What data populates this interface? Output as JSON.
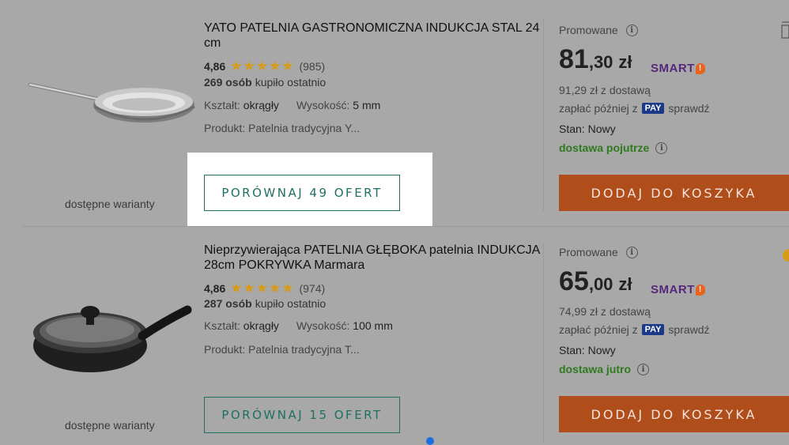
{
  "products": [
    {
      "title": "YATO PATELNIA GASTRONOMICZNA INDUKCJA STAL 24 cm",
      "rating": "4,86",
      "stars": "★★★★★",
      "reviews": "(985)",
      "bought_count": "269 osób",
      "bought_label": "kupiło ostatnio",
      "shape_label": "Kształt:",
      "shape_value": "okrągły",
      "height_label": "Wysokość:",
      "height_value": "5 mm",
      "product_line": "Produkt: Patelnia tradycyjna Y...",
      "variants_label": "dostępne warianty",
      "compare_label": "PORÓWNAJ 49 OFERT",
      "promo_label": "Promowane",
      "price_int": "81",
      "price_dec": ",30",
      "currency": "zł",
      "smart_label": "SMART",
      "delivery_price": "91,29 zł z dostawą",
      "pay_prefix": "zapłać później z",
      "pay_badge": "PAY",
      "pay_suffix": "sprawdź",
      "state_label": "Stan:",
      "state_value": "Nowy",
      "shipping": "dostawa pojutrze",
      "cart_label": "DODAJ DO KOSZYKA"
    },
    {
      "title": "Nieprzywierająca PATELNIA GŁĘBOKA patelnia INDUKCJA 28cm POKRYWKA Marmara",
      "rating": "4,86",
      "stars": "★★★★★",
      "reviews": "(974)",
      "bought_count": "287 osób",
      "bought_label": "kupiło ostatnio",
      "shape_label": "Kształt:",
      "shape_value": "okrągły",
      "height_label": "Wysokość:",
      "height_value": "100 mm",
      "product_line": "Produkt: Patelnia tradycyjna T...",
      "variants_label": "dostępne warianty",
      "compare_label": "PORÓWNAJ 15 OFERT",
      "promo_label": "Promowane",
      "price_int": "65",
      "price_dec": ",00",
      "currency": "zł",
      "smart_label": "SMART",
      "delivery_price": "74,99 zł z dostawą",
      "pay_prefix": "zapłać później z",
      "pay_badge": "PAY",
      "pay_suffix": "sprawdź",
      "state_label": "Stan:",
      "state_value": "Nowy",
      "shipping": "dostawa jutro",
      "cart_label": "DODAJ DO KOSZYKA"
    }
  ],
  "icons": {
    "info": "i",
    "smart_badge": "!"
  },
  "colors": {
    "accent_teal": "#1f6f62",
    "cart_orange": "#b04e1b",
    "smart_purple": "#56287a",
    "shipping_green": "#2f7a1f",
    "star_gold": "#d99a17"
  }
}
